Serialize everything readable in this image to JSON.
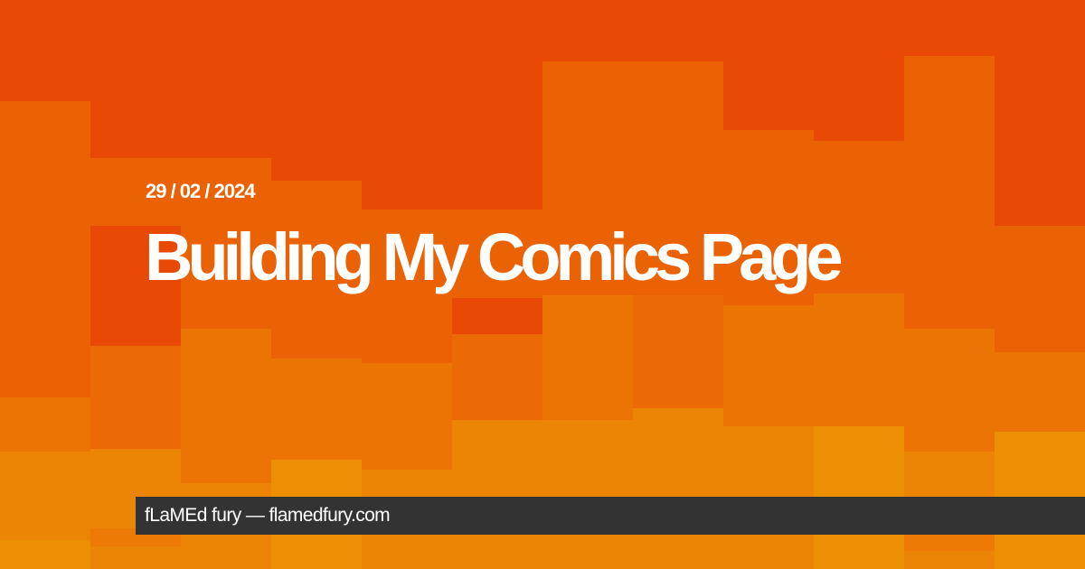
{
  "post": {
    "date": "29 / 02 / 2024",
    "title": "Building My Comics Page"
  },
  "footer": {
    "site_text": "fLaMEd fury — flamedfury.com"
  },
  "colors": {
    "background_top": "#e84a05",
    "background_mid": "#eb6205",
    "background_low": "#ec7405",
    "background_bottom": "#ec8505",
    "footer_bar": "#333333",
    "text": "#ffffff"
  }
}
